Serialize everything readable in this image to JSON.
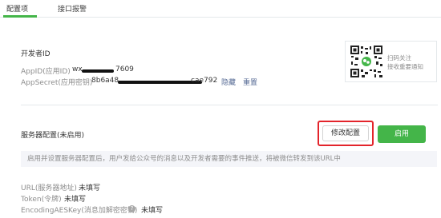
{
  "tabs": [
    {
      "label": "配置项",
      "active": true
    },
    {
      "label": "接口报警",
      "active": false
    }
  ],
  "developer": {
    "section_title": "开发者ID",
    "appid_label": "AppID(应用ID)",
    "appid_prefix": "wx",
    "appid_suffix": "7609",
    "appsecret_label": "AppSecret(应用密钥)",
    "appsecret_prefix": "8b6a48",
    "appsecret_suffix": "cae792",
    "hide_link": "隐藏",
    "reset_link": "重置"
  },
  "qr": {
    "line1": "扫码关注",
    "line2": "接收重要通知"
  },
  "server": {
    "section_title": "服务器配置(未启用)",
    "modify_button": "修改配置",
    "enable_button": "启用",
    "description": "启用并设置服务器配置后，用户发给公众号的消息以及开发者需要的事件推送，将被微信转发到该URL中",
    "url_label": "URL(服务器地址)",
    "url_value": "未填写",
    "token_label": "Token(令牌)",
    "token_value": "未填写",
    "aes_label": "EncodingAESKey(消息加解密密钥)",
    "aes_help": "?",
    "aes_value": "未填写"
  },
  "colors": {
    "accent_green": "#44b549",
    "link_blue": "#576b95",
    "highlight_red": "#e3242b"
  }
}
